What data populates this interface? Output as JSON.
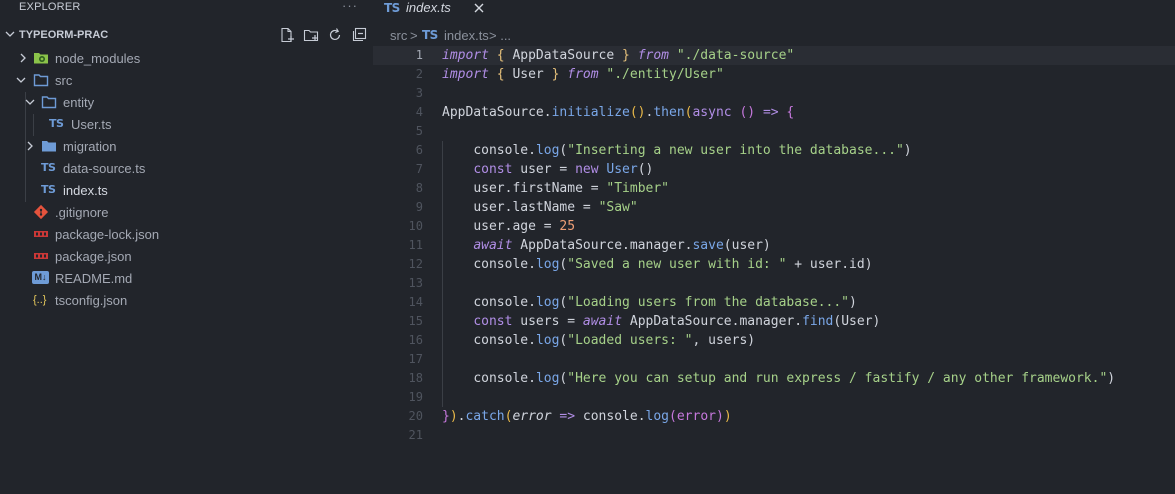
{
  "explorer": {
    "title": "EXPLORER",
    "more": "···"
  },
  "project": {
    "name": "TYPEORM-PRAC"
  },
  "tree": [
    {
      "label": "node_modules",
      "kind": "folder-green"
    },
    {
      "label": "src",
      "kind": "folder-open"
    },
    {
      "label": "entity",
      "kind": "folder-open"
    },
    {
      "label": "User.ts",
      "kind": "ts",
      "icon": "TS"
    },
    {
      "label": "migration",
      "kind": "folder"
    },
    {
      "label": "data-source.ts",
      "kind": "ts",
      "icon": "TS"
    },
    {
      "label": "index.ts",
      "kind": "ts",
      "icon": "TS"
    },
    {
      "label": ".gitignore",
      "kind": "git"
    },
    {
      "label": "package-lock.json",
      "kind": "npm"
    },
    {
      "label": "package.json",
      "kind": "npm"
    },
    {
      "label": "README.md",
      "kind": "md",
      "icon": "M↓"
    },
    {
      "label": "tsconfig.json",
      "kind": "json",
      "icon": "{..}"
    }
  ],
  "tab": {
    "icon": "TS",
    "label": "index.ts"
  },
  "breadcrumb": {
    "folder": "src",
    "sep": ">",
    "icon": "TS",
    "file": "index.ts",
    "tail": "> ..."
  },
  "editor": {
    "line_numbers": [
      "1",
      "2",
      "3",
      "4",
      "5",
      "6",
      "7",
      "8",
      "9",
      "10",
      "11",
      "12",
      "13",
      "14",
      "15",
      "16",
      "17",
      "18",
      "19",
      "20",
      "21"
    ],
    "line1": {
      "import": "import",
      "lb": "{",
      "name": "AppDataSource",
      "rb": "}",
      "from": "from",
      "path": "\"./data-source\""
    },
    "line2": {
      "import": "import",
      "lb": "{",
      "name": "User",
      "rb": "}",
      "from": "from",
      "path": "\"./entity/User\""
    },
    "line4": {
      "obj": "AppDataSource",
      "dot1": ".",
      "init": "initialize",
      "p1": "()",
      "dot2": ".",
      "then": "then",
      "p2": "(",
      "async": "async",
      "p3": "()",
      "arrow": "=>",
      "brace": "{"
    },
    "line6": {
      "obj": "console",
      "dot": ".",
      "fn": "log",
      "po": "(",
      "str": "\"Inserting a new user into the database...\"",
      "pc": ")"
    },
    "line7": {
      "kw": "const",
      "name": "user",
      "eq": "=",
      "new": "new",
      "cls": "User",
      "p": "()"
    },
    "line8": {
      "obj": "user",
      "prop": ".firstName",
      "eq": "=",
      "str": "\"Timber\""
    },
    "line9": {
      "obj": "user",
      "prop": ".lastName",
      "eq": "=",
      "str": "\"Saw\""
    },
    "line10": {
      "obj": "user",
      "prop": ".age",
      "eq": "=",
      "num": "25"
    },
    "line11": {
      "await": "await",
      "obj": "AppDataSource",
      "prop": ".manager.",
      "fn": "save",
      "args": "(user)"
    },
    "line12": {
      "obj": "console",
      "dot": ".",
      "fn": "log",
      "po": "(",
      "str": "\"Saved a new user with id: \"",
      "rest": " + user.id",
      "pc": ")"
    },
    "line14": {
      "obj": "console",
      "dot": ".",
      "fn": "log",
      "po": "(",
      "str": "\"Loading users from the database...\"",
      "pc": ")"
    },
    "line15": {
      "kw": "const",
      "name": "users",
      "eq": "=",
      "await": "await",
      "obj": "AppDataSource",
      "prop": ".manager.",
      "fn": "find",
      "args": "(User)"
    },
    "line16": {
      "obj": "console",
      "dot": ".",
      "fn": "log",
      "po": "(",
      "str": "\"Loaded users: \"",
      "rest": ", users",
      "pc": ")"
    },
    "line18": {
      "obj": "console",
      "dot": ".",
      "fn": "log",
      "po": "(",
      "str": "\"Here you can setup and run express / fastify / any other framework.\"",
      "pc": ")"
    },
    "line20": {
      "rb": "}",
      "rp": ")",
      "dot": ".",
      "catch": "catch",
      "po": "(",
      "err": "error",
      "arrow": "=>",
      "obj": "console",
      "dot2": ".",
      "fn": "log",
      "args": "(error)",
      "pc": ")"
    }
  }
}
